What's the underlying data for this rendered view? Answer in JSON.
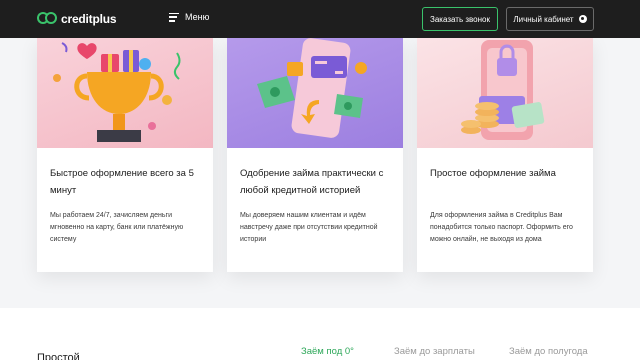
{
  "header": {
    "logo_brand": "creditplus",
    "menu_label": "Меню",
    "call_button": "Заказать звонок",
    "cabinet_button": "Личный кабинет"
  },
  "cards": [
    {
      "title": "Быстрое оформление всего за 5 минут",
      "text": "Мы работаем 24/7, зачисляем деньги мгновенно на карту, банк или платёжную систему",
      "image": "trophy-gifts-illustration"
    },
    {
      "title": "Одобрение займа практически с любой кредитной историей",
      "text": "Мы доверяем нашим клиентам и идём навстречу даже при отсутствии кредитной истории",
      "image": "phone-money-illustration"
    },
    {
      "title": "Простое оформление займа",
      "text": "Для оформления займа в Creditplus Вам понадобится только паспорт. Оформить его можно онлайн, не выходя из дома",
      "image": "phone-lock-coins-illustration"
    }
  ],
  "bottom": {
    "title": "Простой",
    "tabs": [
      {
        "label": "Заём под 0°",
        "active": true
      },
      {
        "label": "Заём до зарплаты",
        "active": false
      },
      {
        "label": "Заём до полугода",
        "active": false
      }
    ]
  },
  "colors": {
    "accent": "#3ac36b",
    "header_bg": "#1e1e1e",
    "card1_bg": "#f6c6cf",
    "card2_bg": "#a98ae6",
    "card3_bg": "#f7d7db"
  }
}
